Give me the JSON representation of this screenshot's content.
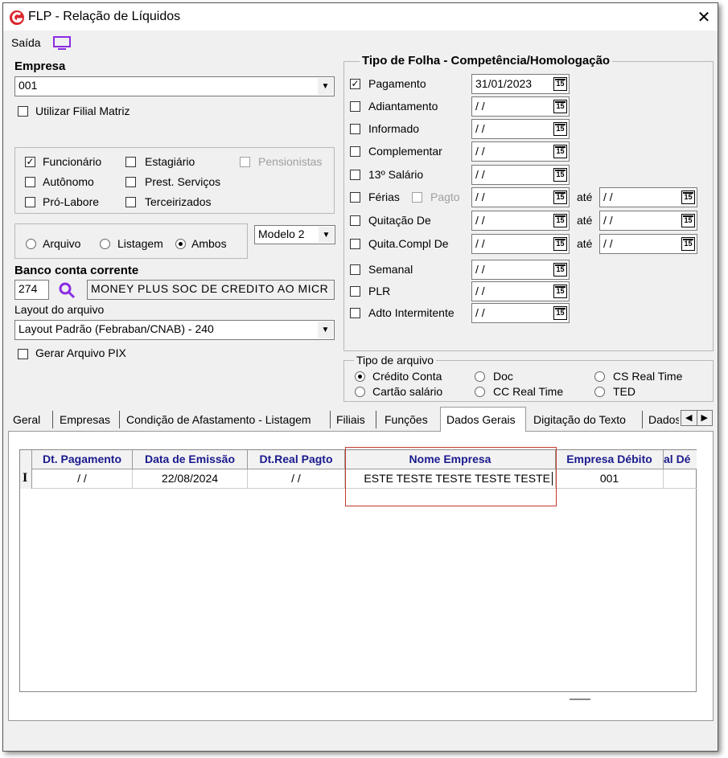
{
  "window": {
    "title": "FLP - Relação de Líquidos",
    "close": "✕"
  },
  "toolbar": {
    "saida_label": "Saída"
  },
  "empresa": {
    "label": "Empresa",
    "value": "001",
    "filial_label": "Utilizar Filial Matriz"
  },
  "tipos": {
    "funcionario": "Funcionário",
    "estagiario": "Estagiário",
    "pensionistas": "Pensionistas",
    "autonomo": "Autônomo",
    "prest_servicos": "Prest. Serviços",
    "pro_labore": "Pró-Labore",
    "terceirizados": "Terceirizados"
  },
  "saida_tipo": {
    "arquivo": "Arquivo",
    "listagem": "Listagem",
    "ambos": "Ambos",
    "modelo": "Modelo 2"
  },
  "banco": {
    "label": "Banco conta corrente",
    "code": "274",
    "name": "MONEY PLUS SOC DE CREDITO AO MICR"
  },
  "layout": {
    "label": "Layout do arquivo",
    "value": "Layout Padrão (Febraban/CNAB) - 240",
    "pix_label": "Gerar Arquivo PIX"
  },
  "folha": {
    "legend": "Tipo de Folha  -  Competência/Homologação",
    "ate": "até",
    "rows": [
      {
        "label": "Pagamento",
        "date": "31/01/2023"
      },
      {
        "label": "Adiantamento",
        "date": "/ /"
      },
      {
        "label": "Informado",
        "date": "/ /"
      },
      {
        "label": "Complementar",
        "date": "/ /"
      },
      {
        "label": "13º Salário",
        "date": "/ /"
      },
      {
        "label": "Férias",
        "extra": "Pagto",
        "date": "/ /",
        "date2": "/ /"
      },
      {
        "label": "Quitação De",
        "date": "/ /",
        "date2": "/ /"
      },
      {
        "label": "Quita.Compl De",
        "date": "/ /",
        "date2": "/ /"
      },
      {
        "label": "Semanal",
        "date": "/ /"
      },
      {
        "label": "PLR",
        "date": "/ /"
      },
      {
        "label": "Adto Intermitente",
        "date": "/ /"
      }
    ],
    "cal_icon": "15"
  },
  "arquivo": {
    "legend": "Tipo de arquivo",
    "credito_conta": "Crédito Conta",
    "doc": "Doc",
    "cs_real_time": "CS Real Time",
    "cartao_salario": "Cartão salário",
    "cc_real_time": "CC Real Time",
    "ted": "TED"
  },
  "tabs": [
    "Geral",
    "Empresas",
    "Condição de Afastamento - Listagem",
    "Filiais",
    "Funções",
    "Dados Gerais",
    "Digitação do Texto",
    "Dados"
  ],
  "grid": {
    "headers": [
      "Dt. Pagamento",
      "Data de Emissão",
      "Dt.Real Pagto",
      "Nome Empresa",
      "Empresa Débito",
      "al Dé"
    ],
    "row": {
      "indicator": "I",
      "dt_pagamento": "/ /",
      "data_emissao": "22/08/2024",
      "dt_real": "/ /",
      "nome_empresa": "ESTE TESTE TESTE TESTE TESTE",
      "empresa_debito": "001"
    }
  },
  "colors": {
    "header_text": "#1a1a8e",
    "highlight": "#c0392b",
    "accent": "#8a2be2",
    "logo": "#d9262c"
  }
}
